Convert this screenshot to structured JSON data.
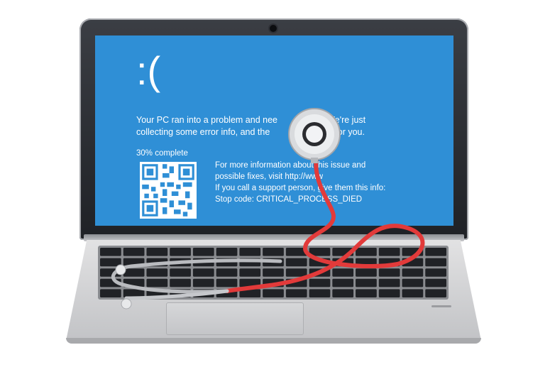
{
  "screen": {
    "sad_face": ":(",
    "message_line1": "Your PC ran into a problem and nee",
    "message_line1_end": "s. We're just",
    "message_line2": "collecting some error info, and the",
    "message_line2_end": "for you.",
    "progress": "30% complete",
    "info_line1": "For more information about this issue and",
    "info_line2": "possible fixes, visit http://www",
    "info_line3": "If you call a support person, give them this info:",
    "info_line4": "Stop code: CRITICAL_PROCESS_DIED"
  },
  "colors": {
    "screen_blue": "#2f8fd6",
    "tube_red": "#e23a3a",
    "chestpiece_silver": "#d9dbde"
  }
}
